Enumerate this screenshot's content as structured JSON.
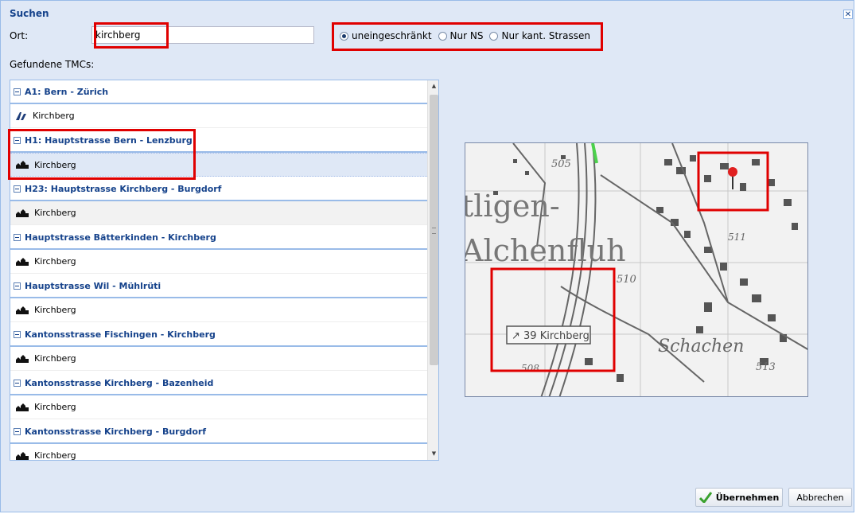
{
  "dialog": {
    "title": "Suchen",
    "close_glyph": "✕",
    "ort_label": "Ort:",
    "ort_value": "kirchberg",
    "found_label": "Gefundene TMCs:",
    "radio_options": [
      {
        "label": "uneingeschränkt",
        "selected": true
      },
      {
        "label": "Nur NS",
        "selected": false
      },
      {
        "label": "Nur kant. Strassen",
        "selected": false
      }
    ]
  },
  "tmc_list": [
    {
      "group": "A1: Bern - Zürich",
      "item": "Kirchberg",
      "icon": "motorway-junction-icon",
      "state": "normal"
    },
    {
      "group": "H1: Hauptstrasse Bern - Lenzburg",
      "item": "Kirchberg",
      "icon": "town-icon",
      "state": "selected"
    },
    {
      "group": "H23: Hauptstrasse Kirchberg - Burgdorf",
      "item": "Kirchberg",
      "icon": "town-icon",
      "state": "alt"
    },
    {
      "group": "Hauptstrasse Bätterkinden - Kirchberg",
      "item": "Kirchberg",
      "icon": "town-icon",
      "state": "normal"
    },
    {
      "group": "Hauptstrasse Wil - Mühlrüti",
      "item": "Kirchberg",
      "icon": "town-icon",
      "state": "normal"
    },
    {
      "group": "Kantonsstrasse Fischingen - Kirchberg",
      "item": "Kirchberg",
      "icon": "town-icon",
      "state": "normal"
    },
    {
      "group": "Kantonsstrasse Kirchberg - Bazenheid",
      "item": "Kirchberg",
      "icon": "town-icon",
      "state": "normal"
    },
    {
      "group": "Kantonsstrasse Kirchberg - Burgdorf",
      "item": "Kirchberg",
      "icon": "town-icon",
      "state": "normal"
    }
  ],
  "map": {
    "place_labels": [
      "tligen-",
      "Alchenfluh",
      "Schachen"
    ],
    "elevations": [
      "505",
      "510",
      "511",
      "513",
      "508"
    ],
    "exit_sign": "↗ 39 Kirchberg",
    "marker_color": "#e02020"
  },
  "buttons": {
    "ok_label": "Übernehmen",
    "cancel_label": "Abbrechen"
  },
  "colors": {
    "highlight_box": "#e00000",
    "header_text": "#15428b",
    "accent_border": "#99bbe8"
  }
}
